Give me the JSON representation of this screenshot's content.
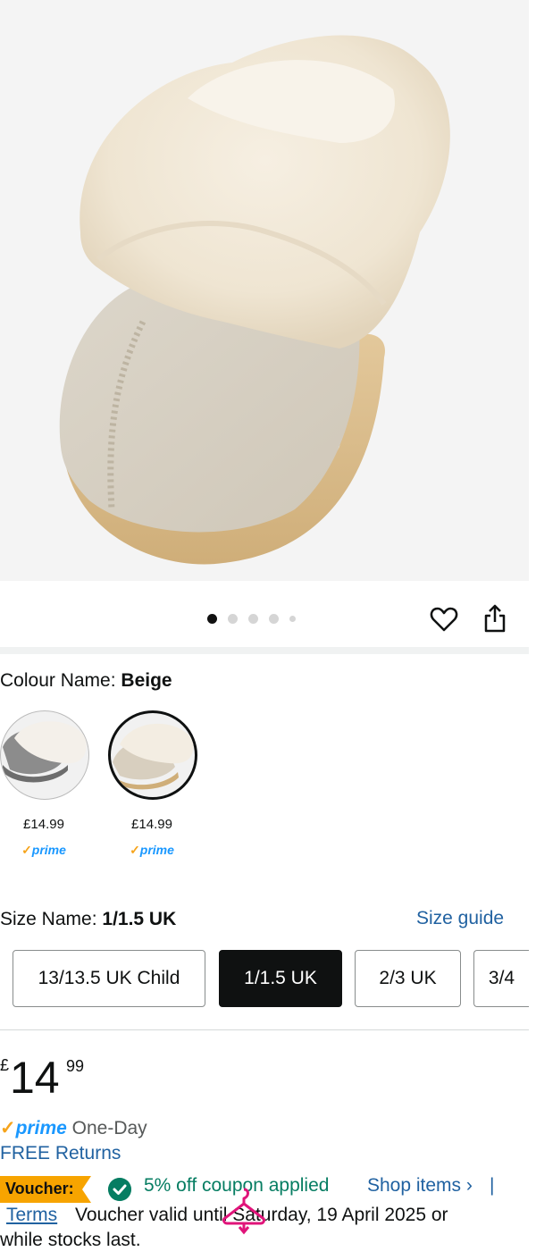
{
  "product_image": {
    "description_icon": "slipper-image"
  },
  "gallery": {
    "dot_count": 5,
    "active_index": 0,
    "wishlist_icon": "heart-icon",
    "share_icon": "share-icon"
  },
  "colour": {
    "label": "Colour Name:",
    "value": "Beige"
  },
  "swatches": [
    {
      "name": "grey",
      "price": "£14.99",
      "prime": "prime",
      "selected": false
    },
    {
      "name": "beige",
      "price": "£14.99",
      "prime": "prime",
      "selected": true
    }
  ],
  "size": {
    "label": "Size Name:",
    "value": "1/1.5 UK",
    "guide": "Size guide",
    "options": [
      "13/13.5 UK Child",
      "1/1.5 UK",
      "2/3 UK",
      "3/4"
    ]
  },
  "price": {
    "currency": "£",
    "whole": "14",
    "fraction": "99"
  },
  "delivery": {
    "prime": "prime",
    "speed": "One-Day",
    "returns": "FREE Returns"
  },
  "voucher": {
    "badge": "Voucher:",
    "applied": "5% off coupon applied",
    "shop": "Shop items ›",
    "pipe": "|",
    "terms": "Terms",
    "valid": "Voucher valid until Saturday, 19 April 2025 or",
    "stocks": "while stocks last."
  },
  "colors": {
    "link": "#2162a1",
    "prime_blue": "#1a98ff",
    "prime_orange": "#f6a41b",
    "green": "#067d62",
    "badge": "#f7a400"
  }
}
